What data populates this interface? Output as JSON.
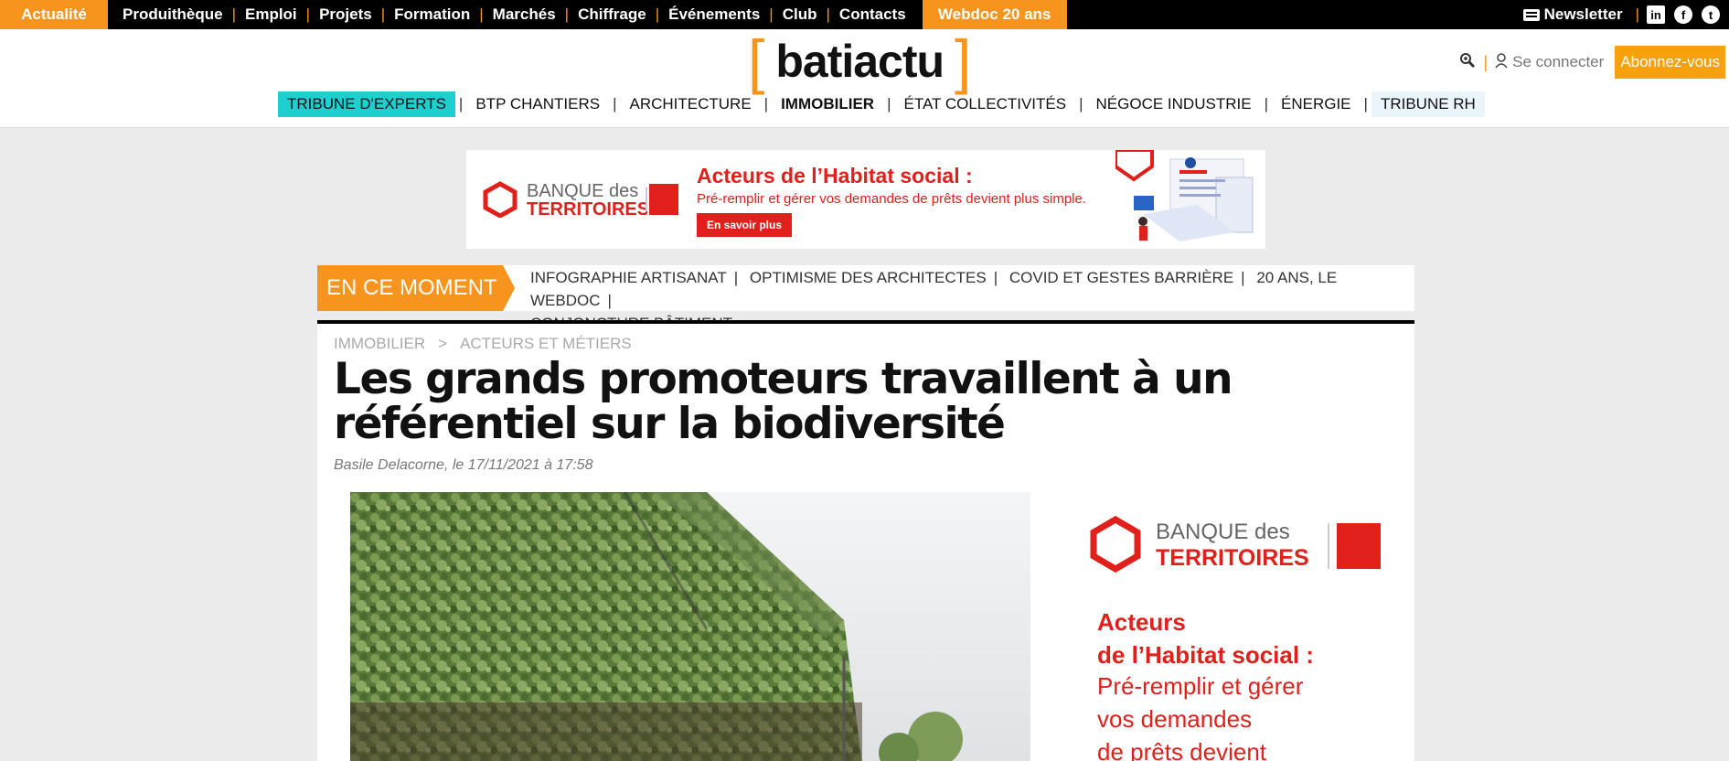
{
  "topbar": {
    "active": "Actualité",
    "links": [
      "Produithèque",
      "Emploi",
      "Projets",
      "Formation",
      "Marchés",
      "Chiffrage",
      "Événements",
      "Club",
      "Contacts"
    ],
    "webdoc": "Webdoc 20 ans",
    "newsletter": "Newsletter",
    "social": [
      "in",
      "f",
      "t"
    ]
  },
  "header": {
    "logo_left_bracket": "[",
    "logo_word": "batiactu",
    "logo_right_bracket": "]",
    "login": "Se connecter",
    "subscribe": "Abonnez-vous"
  },
  "nav": {
    "items": [
      "TRIBUNE D'EXPERTS",
      "BTP CHANTIERS",
      "ARCHITECTURE",
      "IMMOBILIER",
      "ÉTAT COLLECTIVITÉS",
      "NÉGOCE INDUSTRIE",
      "ÉNERGIE",
      "TRIBUNE RH"
    ]
  },
  "ad_banner": {
    "brand_line1": "BANQUE des",
    "brand_line2": "TERRITOIRES",
    "headline": "Acteurs de l’Habitat social :",
    "text": "Pré-remplir et gérer vos demandes de prêts devient plus simple.",
    "button": "En savoir plus"
  },
  "moment": {
    "label": "EN CE MOMENT",
    "links": [
      "INFOGRAPHIE ARTISANAT",
      "OPTIMISME DES ARCHITECTES",
      "COVID ET GESTES BARRIÈRE",
      "20 ANS, LE WEBDOC",
      "CONJONCTURE BÂTIMENT"
    ]
  },
  "article": {
    "breadcrumb": [
      "IMMOBILIER",
      "ACTEURS ET MÉTIERS"
    ],
    "breadcrumb_sep": ">",
    "title": "Les grands promoteurs travaillent à un référentiel sur la biodiversité",
    "byline": "Basile Delacorne, le 17/11/2021 à 17:58"
  },
  "side_ad": {
    "brand_line1": "BANQUE des",
    "brand_line2": "TERRITOIRES",
    "headline_line1": "Acteurs",
    "headline_line2": "de l’Habitat social :",
    "text_line1": "Pré-remplir et gérer",
    "text_line2": "vos demandes",
    "text_line3": "de prêts devient"
  },
  "colors": {
    "brand_orange": "#f7941d",
    "experts_teal": "#1ecfcf",
    "banque_red": "#e1201b",
    "subscribe_orange": "#f7a10c"
  },
  "icons": [
    "search-icon",
    "user-icon",
    "newsletter-icon",
    "linkedin-icon",
    "facebook-icon",
    "twitter-icon"
  ]
}
